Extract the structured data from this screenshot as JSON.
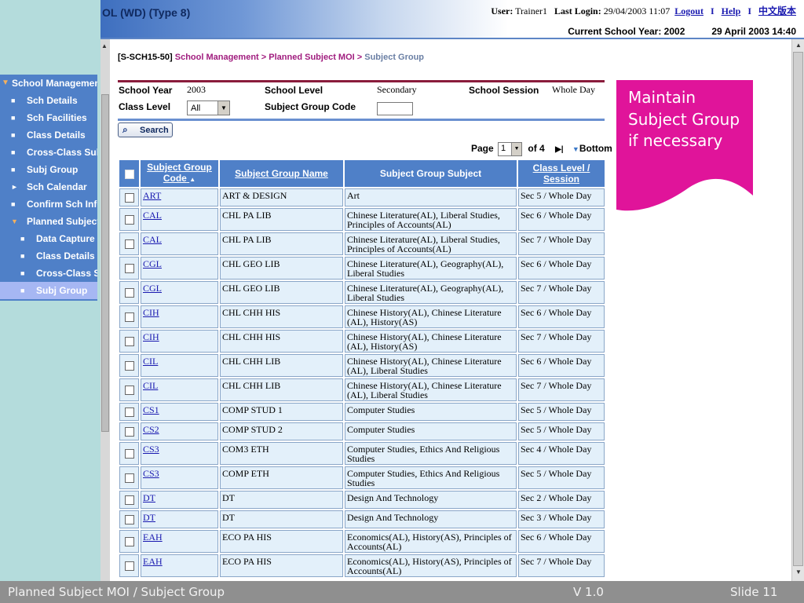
{
  "header": {
    "app_title": "OL (WD) (Type 8)",
    "user_label": "User:",
    "user_value": "Trainer1",
    "last_login_label": "Last Login:",
    "last_login_value": "29/04/2003 11:07",
    "logout": "Logout",
    "help": "Help",
    "chinese": "中文版本",
    "separator": "I",
    "school_year_text": "Current School Year: 2002",
    "datetime": "29 April 2003 14:40"
  },
  "sidebar": {
    "items": [
      {
        "label": "School Management",
        "mark": "▼"
      },
      {
        "label": "Sch Details",
        "mark": "■"
      },
      {
        "label": "Sch Facilities",
        "mark": "■"
      },
      {
        "label": "Class Details",
        "mark": "■"
      },
      {
        "label": "Cross-Class Subj",
        "mark": "■"
      },
      {
        "label": "Subj Group",
        "mark": "■"
      },
      {
        "label": "Sch Calendar",
        "mark": "►"
      },
      {
        "label": "Confirm Sch Info",
        "mark": "■"
      },
      {
        "label": "Planned Subject MOI",
        "mark": "▼"
      },
      {
        "label": "Data Capture",
        "mark": "■"
      },
      {
        "label": "Class Details",
        "mark": "■"
      },
      {
        "label": "Cross-Class Subj",
        "mark": "■"
      },
      {
        "label": "Subj Group",
        "mark": "■"
      }
    ]
  },
  "breadcrumb": {
    "code": "[S-SCH15-50]",
    "level1": "School Management",
    "separator": ">",
    "level2": "Planned Subject MOI",
    "level3": "Subject Group"
  },
  "filters": {
    "school_year_label": "School Year",
    "school_year_value": "2003",
    "school_level_label": "School Level",
    "school_level_value": "Secondary",
    "school_session_label": "School Session",
    "school_session_value": "Whole Day",
    "class_level_label": "Class Level",
    "class_level_value": "All",
    "subject_group_code_label": "Subject Group Code",
    "subject_group_code_value": "",
    "search_label": "Search"
  },
  "pager": {
    "page_label": "Page",
    "page_value": "1",
    "of_text": "of 4",
    "last_glyph": "▶|",
    "bottom_label": "Bottom"
  },
  "table": {
    "headers": {
      "code": "Subject Group Code",
      "sort_glyph": "▲",
      "name": "Subject Group Name",
      "subject": "Subject Group Subject",
      "level": "Class Level / Session"
    },
    "rows": [
      {
        "code": "ART",
        "name": "ART & DESIGN",
        "subject": "Art",
        "level": "Sec 5 / Whole Day"
      },
      {
        "code": "CAL",
        "name": "CHL PA LIB",
        "subject": "Chinese Literature(AL), Liberal Studies, Principles of Accounts(AL)",
        "level": "Sec 6 / Whole Day"
      },
      {
        "code": "CAL",
        "name": "CHL PA LIB",
        "subject": "Chinese Literature(AL), Liberal Studies, Principles of Accounts(AL)",
        "level": "Sec 7 / Whole Day"
      },
      {
        "code": "CGL",
        "name": "CHL GEO LIB",
        "subject": "Chinese Literature(AL), Geography(AL), Liberal Studies",
        "level": "Sec 6 / Whole Day"
      },
      {
        "code": "CGL",
        "name": "CHL GEO LIB",
        "subject": "Chinese Literature(AL), Geography(AL), Liberal Studies",
        "level": "Sec 7 / Whole Day"
      },
      {
        "code": "CIH",
        "name": "CHL CHH HIS",
        "subject": "Chinese History(AL), Chinese Literature (AL), History(AS)",
        "level": "Sec 6 / Whole Day"
      },
      {
        "code": "CIH",
        "name": "CHL CHH HIS",
        "subject": "Chinese History(AL), Chinese Literature (AL), History(AS)",
        "level": "Sec 7 / Whole Day"
      },
      {
        "code": "CIL",
        "name": "CHL CHH LIB",
        "subject": "Chinese History(AL), Chinese Literature (AL), Liberal Studies",
        "level": "Sec 6 / Whole Day"
      },
      {
        "code": "CIL",
        "name": "CHL CHH LIB",
        "subject": "Chinese History(AL), Chinese Literature (AL), Liberal Studies",
        "level": "Sec 7 / Whole Day"
      },
      {
        "code": "CS1",
        "name": "COMP STUD 1",
        "subject": "Computer Studies",
        "level": "Sec 5 / Whole Day"
      },
      {
        "code": "CS2",
        "name": "COMP STUD 2",
        "subject": "Computer Studies",
        "level": "Sec 5 / Whole Day"
      },
      {
        "code": "CS3",
        "name": "COM3 ETH",
        "subject": "Computer Studies, Ethics And Religious Studies",
        "level": "Sec 4 / Whole Day"
      },
      {
        "code": "CS3",
        "name": "COMP ETH",
        "subject": "Computer Studies, Ethics And Religious Studies",
        "level": "Sec 5 / Whole Day"
      },
      {
        "code": "DT",
        "name": "DT",
        "subject": "Design And Technology",
        "level": "Sec 2 / Whole Day"
      },
      {
        "code": "DT",
        "name": "DT",
        "subject": "Design And Technology",
        "level": "Sec 3 / Whole Day"
      },
      {
        "code": "EAH",
        "name": "ECO PA HIS",
        "subject": "Economics(AL), History(AS), Principles of Accounts(AL)",
        "level": "Sec 6 / Whole Day"
      },
      {
        "code": "EAH",
        "name": "ECO PA HIS",
        "subject": "Economics(AL), History(AS), Principles of Accounts(AL)",
        "level": "Sec 7 / Whole Day"
      }
    ]
  },
  "callout": {
    "text": "Maintain Subject Group if necessary",
    "color": "#e0149a"
  },
  "footer": {
    "title": "Planned Subject MOI / Subject Group",
    "version": "V 1.0",
    "slide": "Slide 11"
  }
}
